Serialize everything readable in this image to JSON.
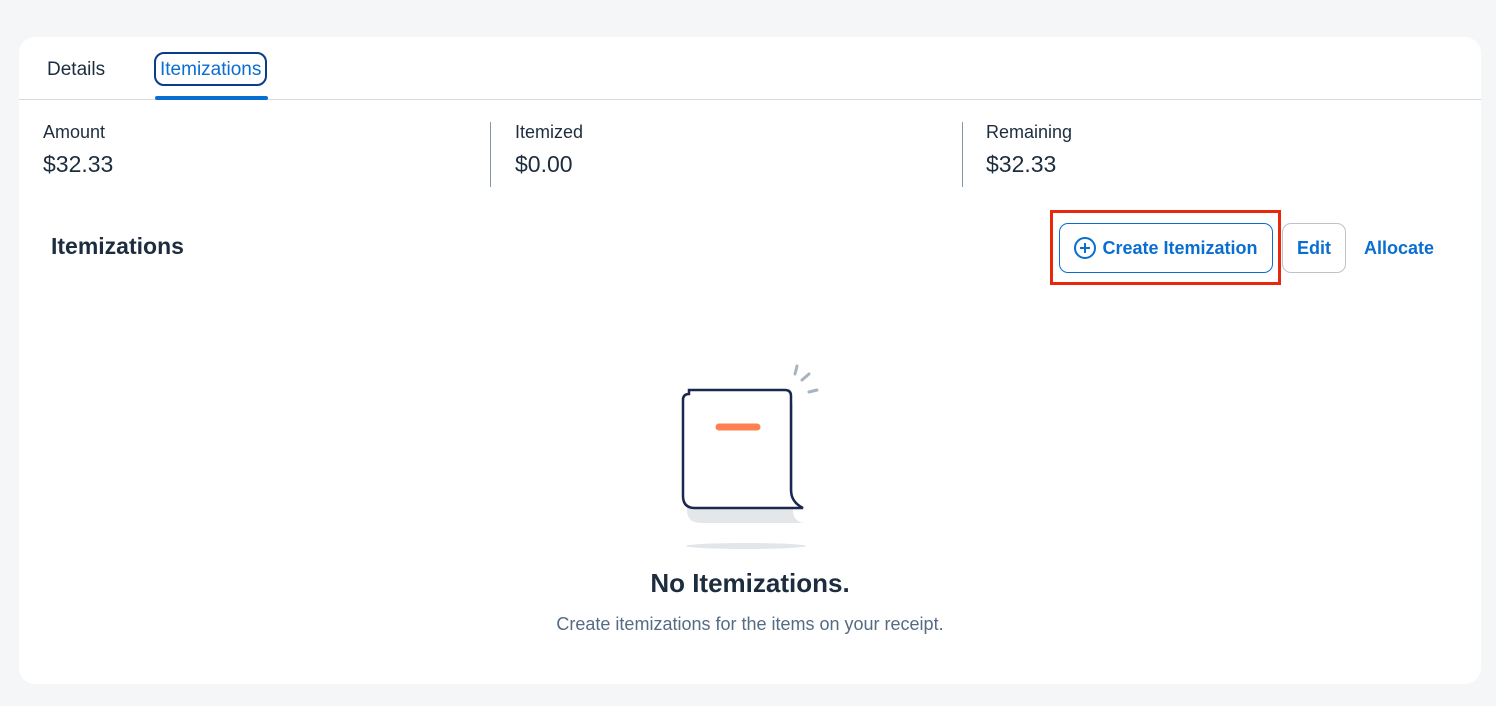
{
  "tabs": [
    {
      "label": "Details",
      "selected": false
    },
    {
      "label": "Itemizations",
      "selected": true
    }
  ],
  "summary": {
    "amount": {
      "label": "Amount",
      "value": "$32.33"
    },
    "itemized": {
      "label": "Itemized",
      "value": "$0.00"
    },
    "remaining": {
      "label": "Remaining",
      "value": "$32.33"
    }
  },
  "section": {
    "title": "Itemizations"
  },
  "toolbar": {
    "create_label": "Create Itemization",
    "create_icon": "plus-circle-icon",
    "edit_label": "Edit",
    "allocate_label": "Allocate"
  },
  "empty_state": {
    "illustration": "receipt-illustration",
    "title": "No Itemizations.",
    "subtitle": "Create itemizations for the items on your receipt."
  },
  "colors": {
    "accent": "#0a6ed1",
    "highlight": "#e8280c",
    "text": "#1d2d3e",
    "receipt_line": "#ff7f50"
  }
}
